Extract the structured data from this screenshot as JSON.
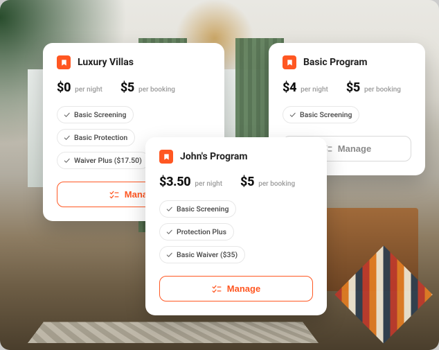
{
  "cards": {
    "luxury": {
      "title": "Luxury Villas",
      "price_night": "$0",
      "per_night": "per night",
      "price_booking": "$5",
      "per_booking": "per booking",
      "features": {
        "0": "Basic Screening",
        "1": "Basic Protection",
        "2": "Waiver Plus ($17.50)"
      },
      "manage_label": "Manage"
    },
    "basic": {
      "title": "Basic Program",
      "price_night": "$4",
      "per_night": "per night",
      "price_booking": "$5",
      "per_booking": "per booking",
      "features": {
        "0": "Basic Screening"
      },
      "manage_label": "Manage"
    },
    "johns": {
      "title": "John's Program",
      "price_night": "$3.50",
      "per_night": "per night",
      "price_booking": "$5",
      "per_booking": "per booking",
      "features": {
        "0": "Basic Screening",
        "1": "Protection Plus",
        "2": "Basic Waiver ($35)"
      },
      "manage_label": "Manage"
    }
  }
}
